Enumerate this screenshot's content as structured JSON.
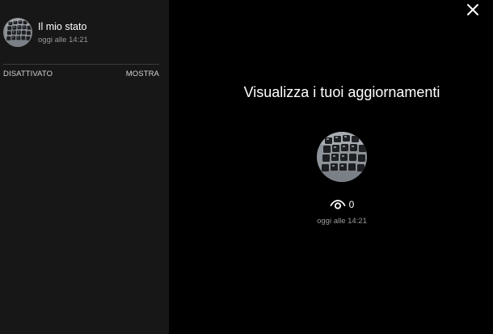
{
  "sidebar": {
    "my_status": {
      "name": "Il mio stato",
      "time": "oggi alle 14:21",
      "avatar": "keyboard-photo"
    },
    "muted_section": {
      "label": "DISATTIVATO",
      "show_label": "MOSTRA"
    }
  },
  "viewer": {
    "close_icon": "close-icon",
    "title": "Visualizza i tuoi aggiornamenti",
    "avatar": "keyboard-photo",
    "views_icon": "eye-icon",
    "views_count": "0",
    "time": "oggi alle 14:21"
  },
  "colors": {
    "sidebar_bg": "#171717",
    "main_bg": "#000000",
    "primary_text": "#ffffff",
    "secondary_text": "#9a9a9a"
  }
}
